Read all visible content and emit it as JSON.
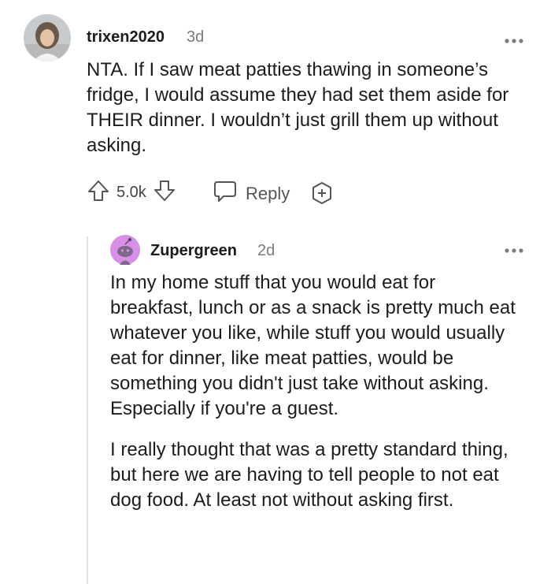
{
  "comment": {
    "username": "trixen2020",
    "age": "3d",
    "body": "NTA. If I saw meat patties thawing in someone’s fridge, I would assume they had set them aside for THEIR dinner. I wouldn’t just grill them up without asking.",
    "votes": "5.0k",
    "reply_label": "Reply",
    "icons": {
      "upvote": "arrow-up-outline-icon",
      "downvote": "arrow-down-outline-icon",
      "reply": "speech-bubble-icon",
      "award": "plus-circle-icon",
      "more": "ellipsis-icon"
    }
  },
  "reply": {
    "username": "Zupergreen",
    "age": "2d",
    "paragraphs": [
      "In my home stuff that you would eat for breakfast, lunch or as a snack is pretty much eat whatever you like, while stuff you would usually eat for dinner, like meat patties, would be something you didn't just take without asking. Especially if you're a guest.",
      "I really thought that was a pretty standard thing, but here we are having to tell people to not eat dog food. At least not without asking first."
    ],
    "avatar_color": "#d78fe8",
    "icons": {
      "more": "ellipsis-icon",
      "avatar": "snoo-avatar-icon"
    }
  }
}
